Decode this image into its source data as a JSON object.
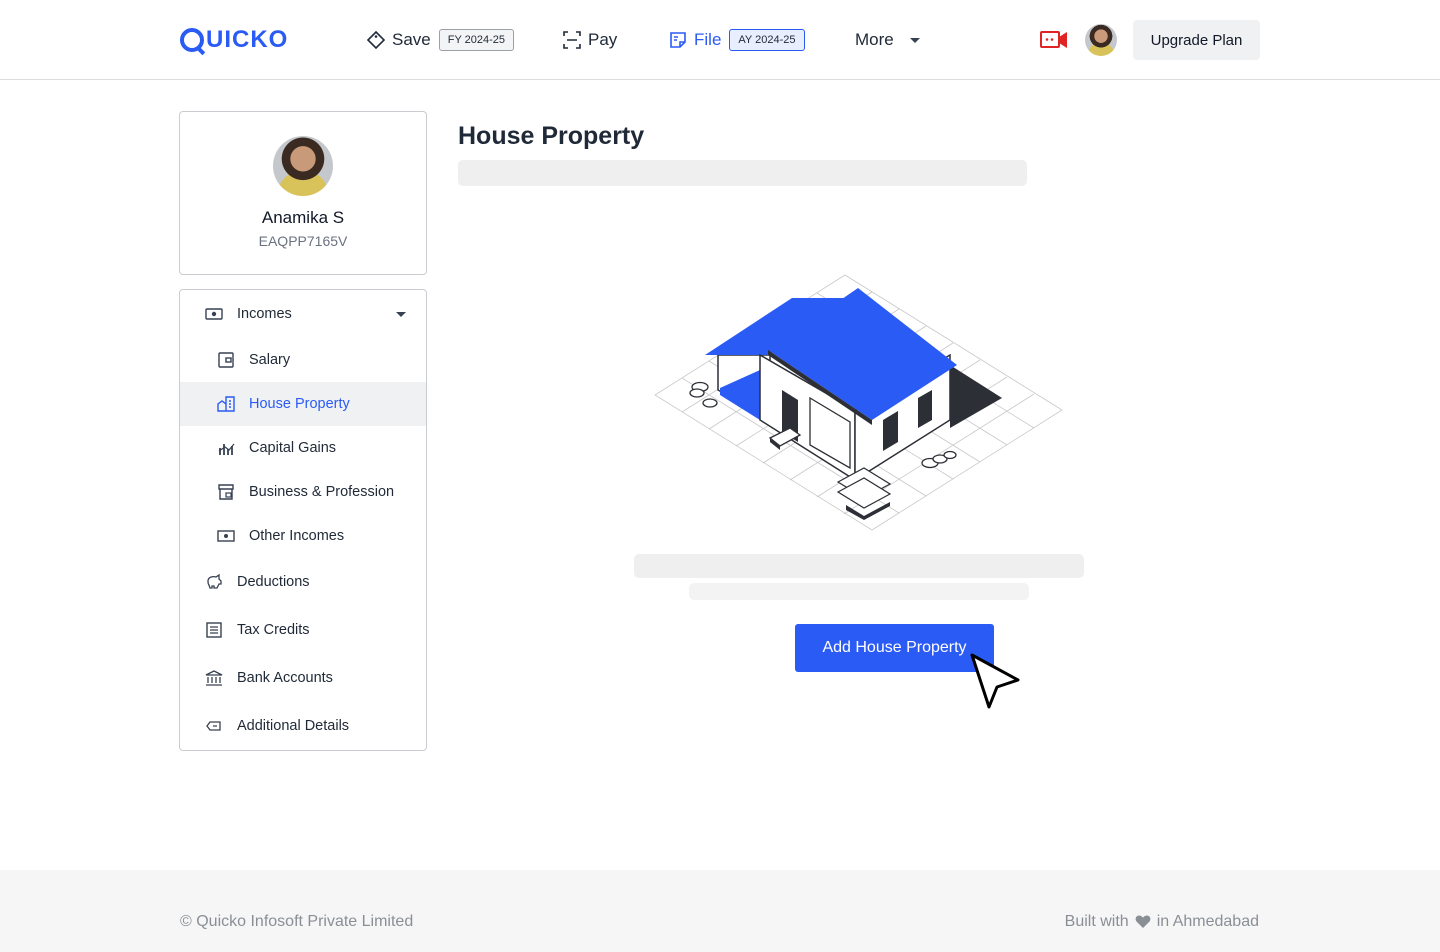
{
  "header": {
    "logo_text": "UICKO",
    "nav": {
      "save_label": "Save",
      "save_badge": "FY 2024-25",
      "pay_label": "Pay",
      "file_label": "File",
      "file_badge": "AY 2024-25",
      "more_label": "More"
    },
    "upgrade_label": "Upgrade Plan"
  },
  "profile": {
    "name": "Anamika S",
    "pan": "EAQPP7165V"
  },
  "sidebar": {
    "items": [
      {
        "label": "Incomes",
        "icon": "cash-icon"
      },
      {
        "label": "Salary",
        "icon": "wallet-icon"
      },
      {
        "label": "House Property",
        "icon": "buildings-icon"
      },
      {
        "label": "Capital Gains",
        "icon": "chart-icon"
      },
      {
        "label": "Business & Profession",
        "icon": "store-icon"
      },
      {
        "label": "Other Incomes",
        "icon": "money-icon"
      },
      {
        "label": "Deductions",
        "icon": "piggy-bank-icon"
      },
      {
        "label": "Tax Credits",
        "icon": "receipt-icon"
      },
      {
        "label": "Bank Accounts",
        "icon": "bank-icon"
      },
      {
        "label": "Additional Details",
        "icon": "tag-icon"
      }
    ]
  },
  "main": {
    "title": "House Property",
    "add_button_label": "Add House Property"
  },
  "footer": {
    "copyright": "© Quicko Infosoft Private Limited",
    "built_with": "Built with",
    "built_location": "in Ahmedabad"
  },
  "colors": {
    "accent": "#2b5bf5",
    "video_icon": "#e02424"
  }
}
